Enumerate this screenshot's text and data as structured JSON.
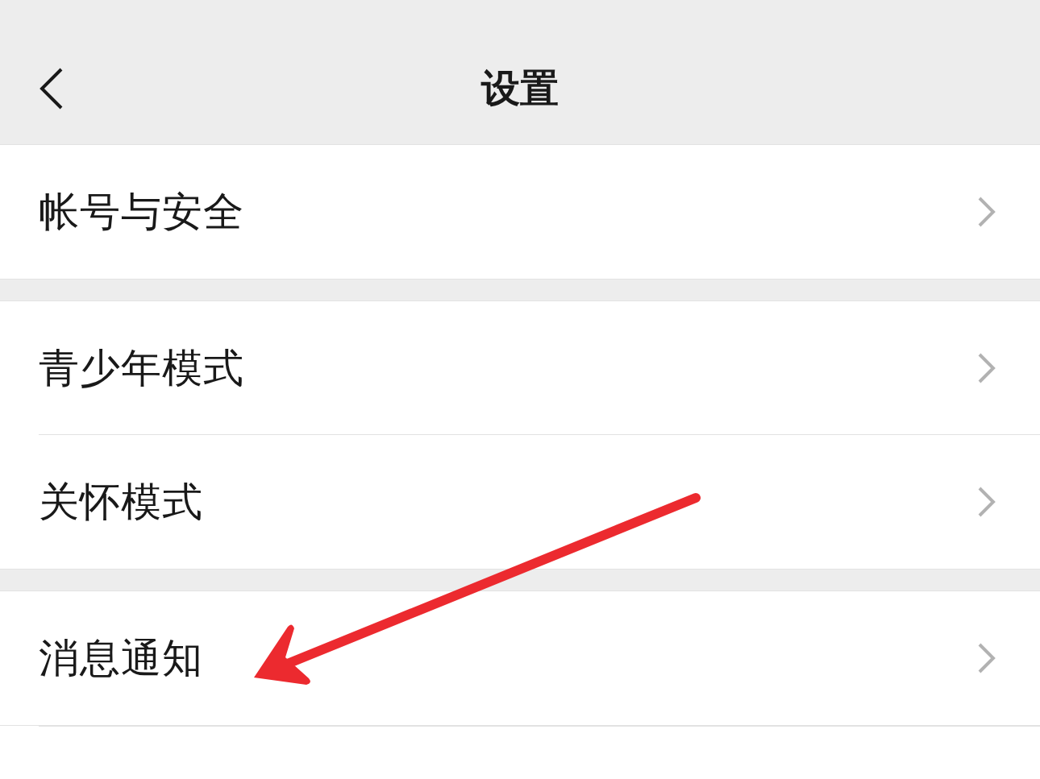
{
  "header": {
    "title": "设置"
  },
  "groups": [
    {
      "items": [
        {
          "label": "帐号与安全"
        }
      ]
    },
    {
      "items": [
        {
          "label": "青少年模式"
        },
        {
          "label": "关怀模式"
        }
      ]
    },
    {
      "items": [
        {
          "label": "消息通知"
        }
      ]
    }
  ],
  "annotation": {
    "kind": "arrow"
  }
}
